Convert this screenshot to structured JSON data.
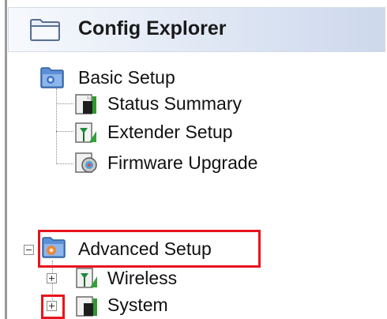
{
  "header": {
    "title": "Config Explorer",
    "icon": "folder-icon"
  },
  "tree": {
    "basic_setup": {
      "label": "Basic Setup",
      "icon": "network-folder-icon",
      "children": [
        {
          "label": "Status Summary",
          "icon": "status-device-icon"
        },
        {
          "label": "Extender Setup",
          "icon": "extender-antenna-icon"
        },
        {
          "label": "Firmware Upgrade",
          "icon": "firmware-disc-icon"
        }
      ]
    },
    "advanced_setup": {
      "label": "Advanced Setup",
      "icon": "advanced-folder-icon",
      "expanded": true,
      "children": [
        {
          "label": "Wireless",
          "icon": "wireless-antenna-icon",
          "expanded": false
        },
        {
          "label": "System",
          "icon": "system-device-icon",
          "expanded": false
        }
      ]
    }
  },
  "colors": {
    "highlight": "#e8141c",
    "header_gradient_end": "#cdd8ec",
    "text": "#111111"
  }
}
